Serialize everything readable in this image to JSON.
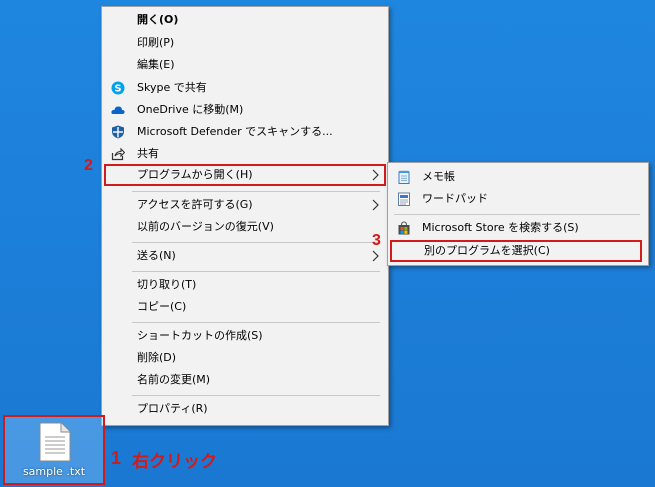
{
  "context_menu": {
    "open": "開く(O)",
    "print": "印刷(P)",
    "edit": "編集(E)",
    "skype_share": "Skype で共有",
    "onedrive_move": "OneDrive に移動(M)",
    "defender_scan": "Microsoft Defender でスキャンする...",
    "share": "共有",
    "open_with": "プログラムから開く(H)",
    "give_access": "アクセスを許可する(G)",
    "restore_previous": "以前のバージョンの復元(V)",
    "send_to": "送る(N)",
    "cut": "切り取り(T)",
    "copy": "コピー(C)",
    "create_shortcut": "ショートカットの作成(S)",
    "delete": "削除(D)",
    "rename": "名前の変更(M)",
    "properties": "プロパティ(R)"
  },
  "open_with_submenu": {
    "notepad": "メモ帳",
    "wordpad": "ワードパッド",
    "search_store": "Microsoft Store を検索する(S)",
    "choose_another": "別のプログラムを選択(C)"
  },
  "desktop": {
    "file_name": "sample .txt"
  },
  "annotations": {
    "step1": "1",
    "step1_text": "右クリック",
    "step2": "2",
    "step3": "3"
  },
  "colors": {
    "highlight": "#d11a1a",
    "menu_bg": "#f2f2f2",
    "desktop_bg": "#1c7ed8"
  },
  "icons": {
    "skype": "skype-icon",
    "onedrive": "onedrive-icon",
    "defender": "defender-icon",
    "share": "share-icon",
    "notepad": "notepad-icon",
    "wordpad": "wordpad-icon",
    "store": "store-icon",
    "file": "text-file-icon"
  }
}
